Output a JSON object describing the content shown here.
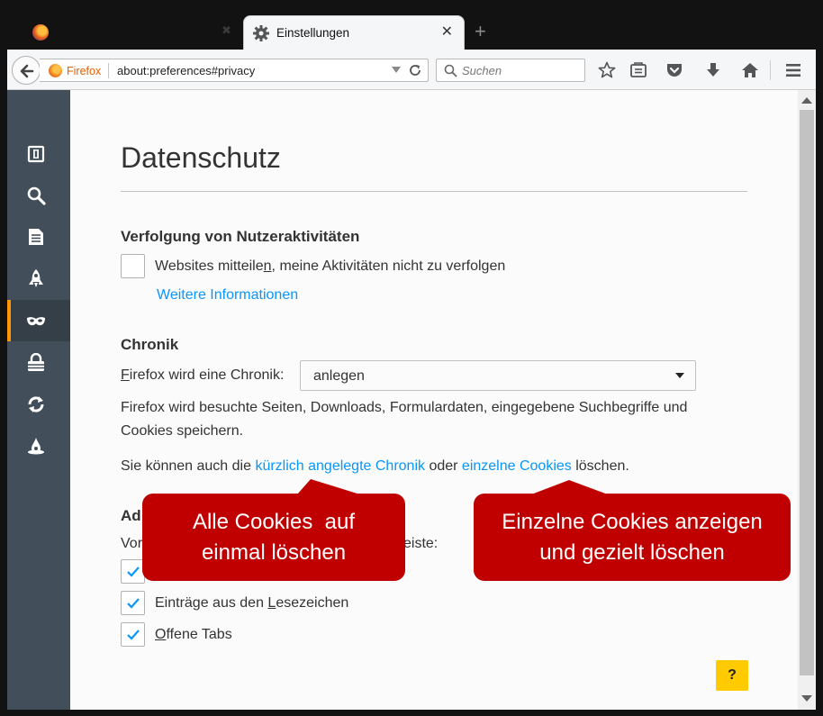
{
  "tabs": {
    "active_title": "Einstellungen",
    "new_tab_glyph": "+"
  },
  "navbar": {
    "identity_label": "Firefox",
    "url": "about:preferences#privacy",
    "search_placeholder": "Suchen",
    "toolbar_icons": [
      "bookmark-star-icon",
      "bookmarks-menu-icon",
      "pocket-icon",
      "downloads-icon",
      "home-icon",
      "menu-icon"
    ]
  },
  "sidebar": {
    "categories": [
      "general-icon",
      "search-icon",
      "content-icon",
      "applications-icon",
      "privacy-icon",
      "security-icon",
      "sync-icon",
      "advanced-icon"
    ],
    "selected": "privacy-icon",
    "accent_color": "#ff9500"
  },
  "privacy": {
    "title": "Datenschutz",
    "tracking": {
      "heading": "Verfolgung von Nutzeraktivitäten",
      "dnt_label_before": "Websites mitteile",
      "dnt_label_accesskey": "n",
      "dnt_label_after": ", meine Aktivitäten nicht zu verfolgen",
      "dnt_checked": false,
      "more_info_link": "Weitere Informationen"
    },
    "history": {
      "heading": "Chronik",
      "mode_label_accesskey": "F",
      "mode_label_rest": "irefox wird eine Chronik:",
      "mode_value": "anlegen",
      "description": "Firefox wird besuchte Seiten, Downloads, Formulardaten, eingegebene Suchbegriffe und Cookies speichern.",
      "clear_text_before": "Sie können auch die ",
      "clear_recent_link": "kürzlich angelegte Chronik",
      "clear_text_middle": " oder ",
      "cookies_link": "einzelne Cookies",
      "clear_text_after": " löschen."
    },
    "locationbar": {
      "heading_visible": "Ad",
      "intro_visible": "Vor",
      "intro_tail_visible": "eiste:",
      "items": [
        {
          "before": "",
          "accesskey": "",
          "after": "",
          "checked": true
        },
        {
          "before": "Einträge aus den ",
          "accesskey": "L",
          "after": "esezeichen",
          "checked": true
        },
        {
          "before": "",
          "accesskey": "O",
          "after": "ffene Tabs",
          "checked": true
        }
      ]
    },
    "help_label": "?"
  },
  "callouts": {
    "left_line1": "Alle Cookies  auf",
    "left_line2": "einmal löschen",
    "right_line1": "Einzelne Cookies anzeigen",
    "right_line2": "und gezielt löschen",
    "color": "#c00000"
  },
  "colors": {
    "link": "#0996f8",
    "sidebar": "#424f5a",
    "help_button": "#ffcb00"
  }
}
